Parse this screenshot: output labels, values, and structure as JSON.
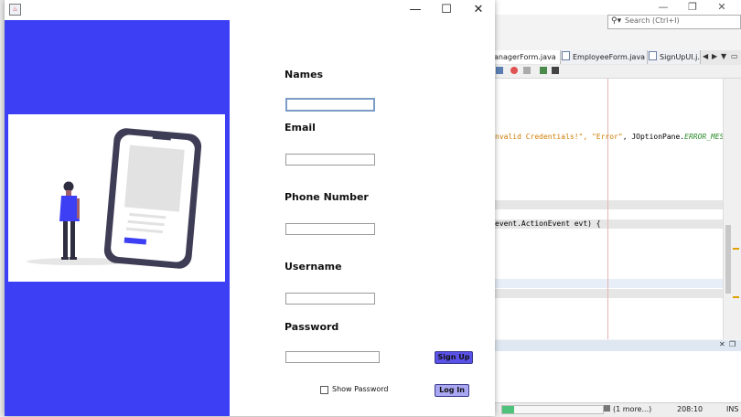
{
  "ide": {
    "search": {
      "placeholder": "Search (Ctrl+I)"
    },
    "tabs": [
      {
        "label": "anagerForm.java"
      },
      {
        "label": "EmployeeForm.java"
      },
      {
        "label": "SignUpUI.j..."
      }
    ],
    "code": {
      "line1a": "nvalid Credentials!\", ",
      "line1b": "\"Error\"",
      "line1c": ", JOptionPane.",
      "line1d": "ERROR_MES",
      "line2": "event.ActionEvent evt) {"
    },
    "status": {
      "progress": 0.12,
      "notifications": "(1 more...)",
      "position": "208:10",
      "mode": "INS"
    }
  },
  "dialog": {
    "form": {
      "names_label": "Names",
      "email_label": "Email",
      "phone_label": "Phone Number",
      "username_label": "Username",
      "password_label": "Password",
      "show_password_label": "Show Password",
      "signup_button": "Sign Up",
      "login_button": "Log In"
    },
    "colors": {
      "panel": "#3d3ff5",
      "signup_button": "#5a52e8",
      "login_button": "#a9a6f2"
    }
  }
}
